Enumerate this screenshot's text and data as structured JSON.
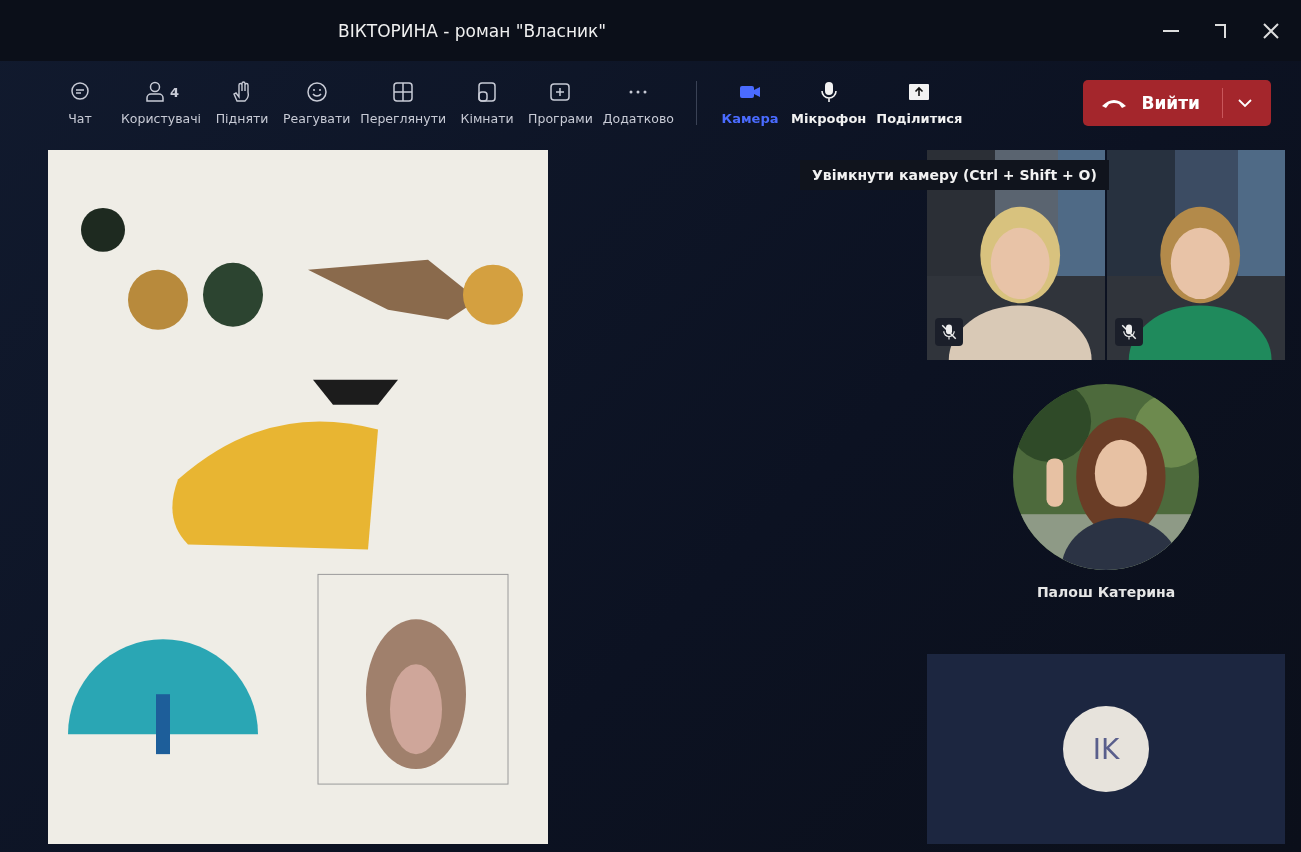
{
  "window": {
    "title": "ВІКТОРИНА - роман \"Власник\""
  },
  "toolbar": {
    "items": [
      {
        "kind": "chat",
        "label": "Чат"
      },
      {
        "kind": "people",
        "label": "Користувачі",
        "badge": "4"
      },
      {
        "kind": "hand",
        "label": "Підняти"
      },
      {
        "kind": "smile",
        "label": "Реагувати"
      },
      {
        "kind": "layout",
        "label": "Переглянути"
      },
      {
        "kind": "rooms",
        "label": "Кімнати"
      },
      {
        "kind": "apps",
        "label": "Програми"
      },
      {
        "kind": "more",
        "label": "Додатково"
      }
    ],
    "devices": [
      {
        "kind": "camera",
        "label": "Камера",
        "active": true
      },
      {
        "kind": "mic",
        "label": "Мікрофон",
        "active": false
      },
      {
        "kind": "share",
        "label": "Поділитися",
        "active": false
      }
    ],
    "leave": {
      "label": "Вийти"
    }
  },
  "tooltip": "Увімкнути камеру (Ctrl + Shift + O)",
  "participants": [
    {
      "kind": "video",
      "muted": true
    },
    {
      "kind": "video",
      "muted": true
    },
    {
      "kind": "round-video",
      "name": "Палош Катерина"
    },
    {
      "kind": "avatar",
      "initials": "IK"
    }
  ]
}
